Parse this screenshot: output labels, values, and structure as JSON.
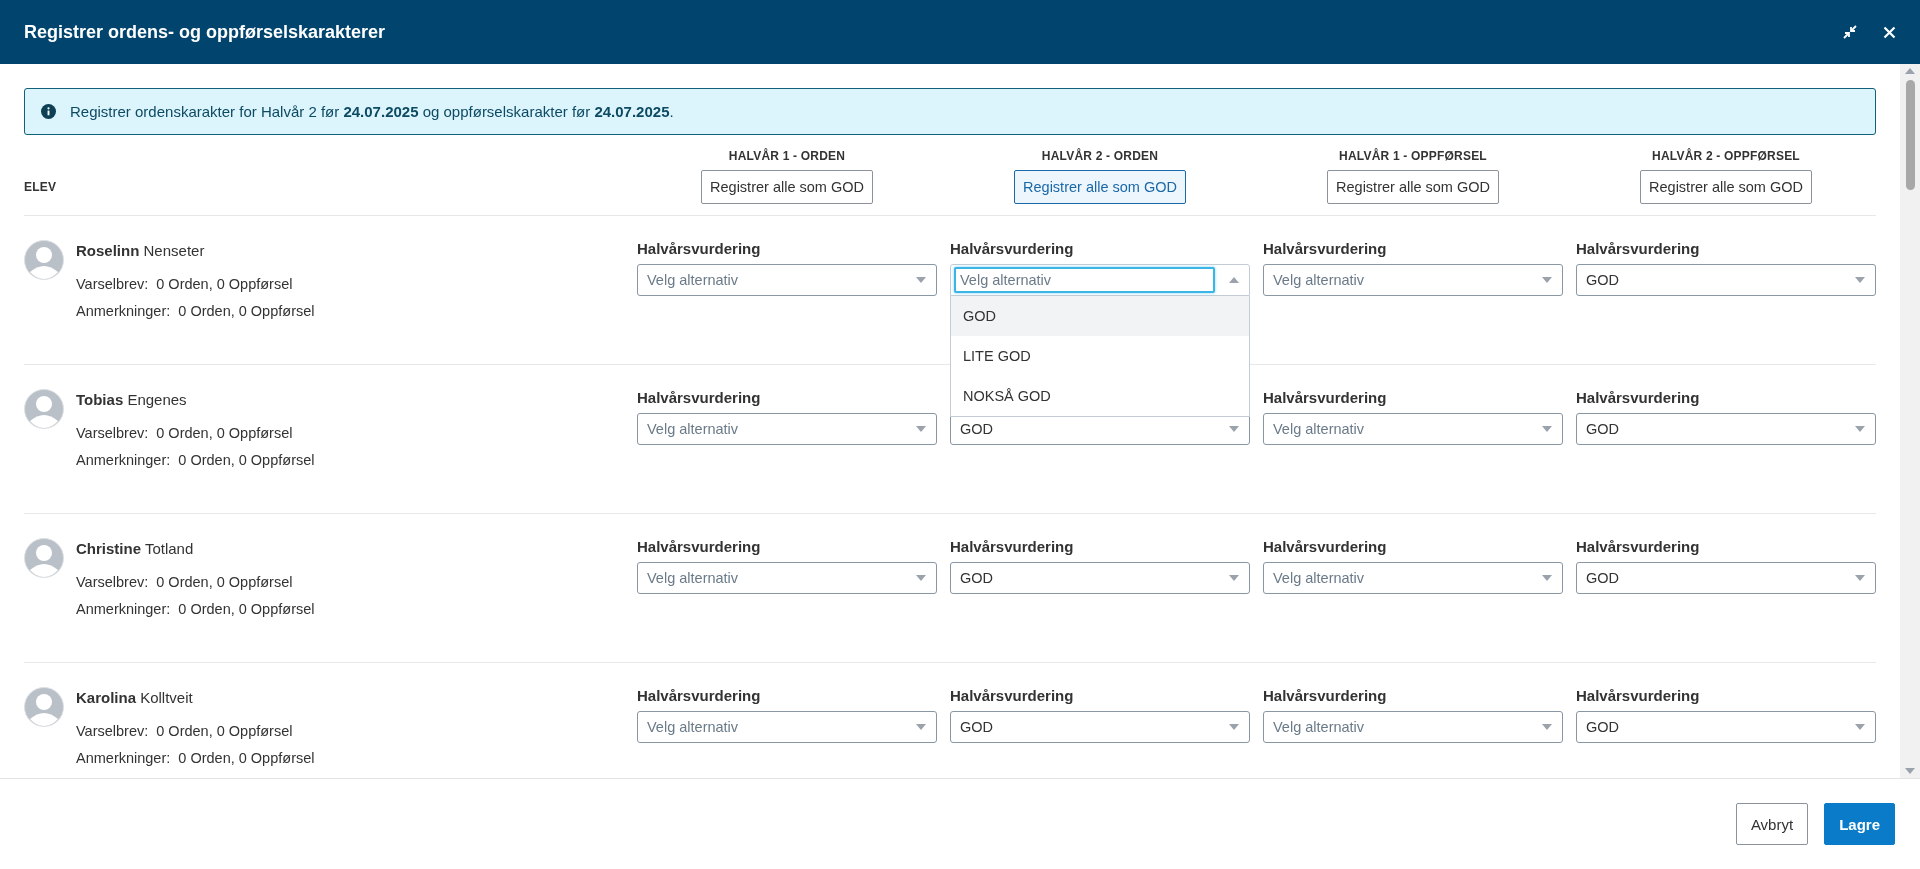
{
  "dialog": {
    "title": "Registrer ordens- og oppførselskarakterer"
  },
  "info": {
    "text": "Registrer ordenskarakter for Halvår 2 før **24.07.2025** og oppførselskarakter før **24.07.2025**."
  },
  "student_heading": "ELEV",
  "grade_columns": [
    {
      "heading": "HALVÅR 1 - ORDEN",
      "button": "Registrer alle som GOD",
      "focused": false
    },
    {
      "heading": "HALVÅR 2 - ORDEN",
      "button": "Registrer alle som GOD",
      "focused": true
    },
    {
      "heading": "HALVÅR 1 - OPPFØRSEL",
      "button": "Registrer alle som GOD",
      "focused": false
    },
    {
      "heading": "HALVÅR 2 - OPPFØRSEL",
      "button": "Registrer alle som GOD",
      "focused": false
    }
  ],
  "students": [
    {
      "first_name": "Roselinn",
      "last_name": "Nenseter",
      "varselbrev_label": "Varselbrev:",
      "varselbrev": "0 Orden, 0 Oppførsel",
      "anmerkninger_label": "Anmerkninger:",
      "anmerkninger": "0 Orden, 0 Oppførsel",
      "grades": [
        {
          "label": "Halvårsvurdering",
          "placeholder": "Velg alternativ",
          "open": false
        },
        {
          "label": "Halvårsvurdering",
          "placeholder": "Velg alternativ",
          "open": true,
          "options": [
            {
              "label": "GOD",
              "selected": true
            },
            {
              "label": "LITE GOD",
              "selected": false
            },
            {
              "label": "NOKSÅ GOD",
              "selected": false
            }
          ]
        },
        {
          "label": "Halvårsvurdering",
          "placeholder": "Velg alternativ",
          "open": false
        },
        {
          "label": "Halvårsvurdering",
          "value": "GOD",
          "open": false
        }
      ]
    },
    {
      "first_name": "Tobias",
      "last_name": "Engenes",
      "varselbrev_label": "Varselbrev:",
      "varselbrev": "0 Orden, 0 Oppførsel",
      "anmerkninger_label": "Anmerkninger:",
      "anmerkninger": "0 Orden, 0 Oppførsel",
      "grades": [
        {
          "label": "Halvårsvurdering",
          "placeholder": "Velg alternativ",
          "open": false
        },
        {
          "value": "GOD",
          "open": false
        },
        {
          "label": "Halvårsvurdering",
          "placeholder": "Velg alternativ",
          "open": false
        },
        {
          "label": "Halvårsvurdering",
          "value": "GOD",
          "open": false
        }
      ]
    },
    {
      "first_name": "Christine",
      "last_name": "Totland",
      "varselbrev_label": "Varselbrev:",
      "varselbrev": "0 Orden, 0 Oppførsel",
      "anmerkninger_label": "Anmerkninger:",
      "anmerkninger": "0 Orden, 0 Oppførsel",
      "grades": [
        {
          "label": "Halvårsvurdering",
          "placeholder": "Velg alternativ",
          "open": false
        },
        {
          "label": "Halvårsvurdering",
          "value": "GOD",
          "open": false
        },
        {
          "label": "Halvårsvurdering",
          "placeholder": "Velg alternativ",
          "open": false
        },
        {
          "label": "Halvårsvurdering",
          "value": "GOD",
          "open": false
        }
      ]
    },
    {
      "first_name": "Karolina",
      "last_name": "Kolltveit",
      "varselbrev_label": "Varselbrev:",
      "varselbrev": "0 Orden, 0 Oppførsel",
      "anmerkninger_label": "Anmerkninger:",
      "anmerkninger": "0 Orden, 0 Oppførsel",
      "grades": [
        {
          "label": "Halvårsvurdering",
          "placeholder": "Velg alternativ",
          "open": false
        },
        {
          "label": "Halvårsvurdering",
          "value": "GOD",
          "open": false
        },
        {
          "label": "Halvårsvurdering",
          "placeholder": "Velg alternativ",
          "open": false
        },
        {
          "label": "Halvårsvurdering",
          "value": "GOD",
          "open": false
        }
      ]
    }
  ],
  "footer": {
    "buttons": [
      {
        "label": "Avbryt",
        "kind": "secondary"
      },
      {
        "label": "Lagre",
        "kind": "primary"
      }
    ]
  }
}
